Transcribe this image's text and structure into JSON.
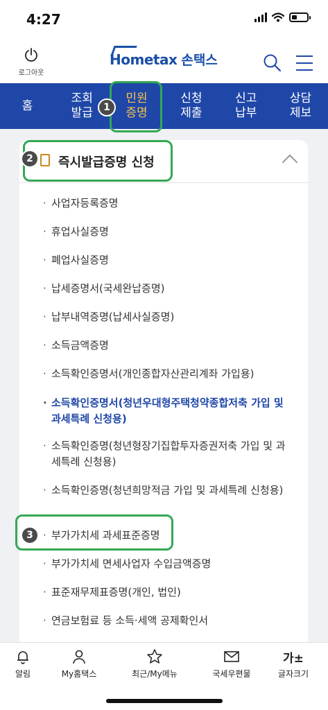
{
  "status_bar": {
    "time": "4:27"
  },
  "header": {
    "logout_label": "로그아웃",
    "logo_en": "Hometax",
    "logo_ko": "손택스"
  },
  "nav": {
    "items": [
      {
        "label": "홈"
      },
      {
        "label": "조회\n발급"
      },
      {
        "label": "민원\n증명"
      },
      {
        "label": "신청\n제출"
      },
      {
        "label": "신고\n납부"
      },
      {
        "label": "상담\n제보"
      }
    ]
  },
  "badges": [
    "1",
    "2",
    "3"
  ],
  "section": {
    "title": "즉시발급증명 신청",
    "items": [
      "사업자등록증명",
      "휴업사실증명",
      "폐업사실증명",
      "납세증명서(국세완납증명)",
      "납부내역증명(납세사실증명)",
      "소득금액증명",
      "소득확인증명서(개인종합자산관리계좌 가입용)",
      "소득확인증명서(청년우대형주택청약종합저축 가입 및 과세특례 신청용)",
      "소득확인증명(청년형장기집합투자증권저축 가입 및 과세특례 신청용)",
      "소득확인증명(청년희망적금 가입 및 과세특례 신청용)",
      "부가가치세 과세표준증명",
      "부가가치세 면세사업자 수입금액증명",
      "표준재무제표증명(개인, 법인)",
      "연금보험료 등 소득·세액 공제확인서"
    ]
  },
  "tabbar": {
    "items": [
      {
        "label": "알림",
        "icon": "bell-icon"
      },
      {
        "label": "My홈택스",
        "icon": "person-icon"
      },
      {
        "label": "최근/My메뉴",
        "icon": "star-icon"
      },
      {
        "label": "국세우편물",
        "icon": "mail-icon"
      },
      {
        "label": "글자크기",
        "icon": "font-size-icon"
      }
    ],
    "font_size_glyph": "가±"
  },
  "colors": {
    "nav_bg": "#1f47a8",
    "nav_active": "#f6c24b",
    "highlight_green": "#34a853",
    "link_blue": "#1f47a8"
  }
}
